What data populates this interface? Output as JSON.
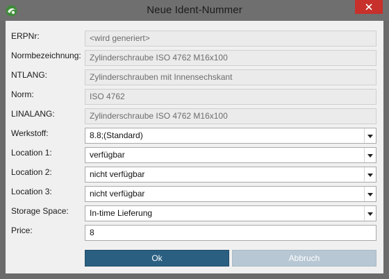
{
  "window": {
    "title": "Neue Ident-Nummer"
  },
  "fields": {
    "erpnr": {
      "label": "ERPNr:",
      "value": "<wird generiert>"
    },
    "normbezeichnung": {
      "label": "Normbezeichnung:",
      "value": "Zylinderschraube ISO 4762 M16x100"
    },
    "ntlang": {
      "label": "NTLANG:",
      "value": "Zylinderschrauben mit Innensechskant"
    },
    "norm": {
      "label": "Norm:",
      "value": "ISO 4762"
    },
    "linalang": {
      "label": "LINALANG:",
      "value": "Zylinderschraube ISO 4762 M16x100"
    },
    "werkstoff": {
      "label": "Werkstoff:",
      "value": "8.8;(Standard)"
    },
    "location1": {
      "label": "Location 1:",
      "value": "verfügbar"
    },
    "location2": {
      "label": "Location 2:",
      "value": "nicht verfügbar"
    },
    "location3": {
      "label": "Location 3:",
      "value": "nicht verfügbar"
    },
    "storage_space": {
      "label": "Storage Space:",
      "value": "In-time Lieferung"
    },
    "price": {
      "label": "Price:",
      "value": "8"
    }
  },
  "buttons": {
    "ok": "Ok",
    "cancel": "Abbruch"
  },
  "colors": {
    "title_bar": "#6f6f6f",
    "close_button": "#c7302b",
    "ok_button": "#2b5f82",
    "cancel_button": "#b7c7d3"
  },
  "icons": {
    "app": "app-logo-icon",
    "close": "close-icon",
    "dropdown": "chevron-down-icon"
  }
}
